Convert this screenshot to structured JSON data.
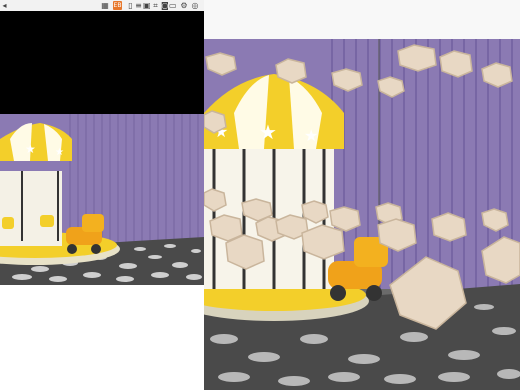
{
  "toolbar": {
    "icons": [
      "arrow-back-icon",
      "undo-icon",
      "grid-icon",
      "settings-icon",
      "layout-icon",
      "crop-icon",
      "image-icon",
      "list-icon",
      "camera-icon",
      "gear-icon",
      "globe-icon",
      "expand-icon"
    ],
    "highlight_label": "EB"
  },
  "colors": {
    "accent": "#e7772b",
    "wall_purple": "#8b7ab3",
    "carousel_yellow": "#f3cf2a",
    "floor_dark": "#4a4a4a",
    "floor_dot": "#cfcfcf",
    "hex_fill": "#e8d8c4"
  },
  "scene": {
    "description_icons": [
      "carousel-icon",
      "rocking-horse-icon",
      "star-icon",
      "hexagon-icon"
    ]
  }
}
